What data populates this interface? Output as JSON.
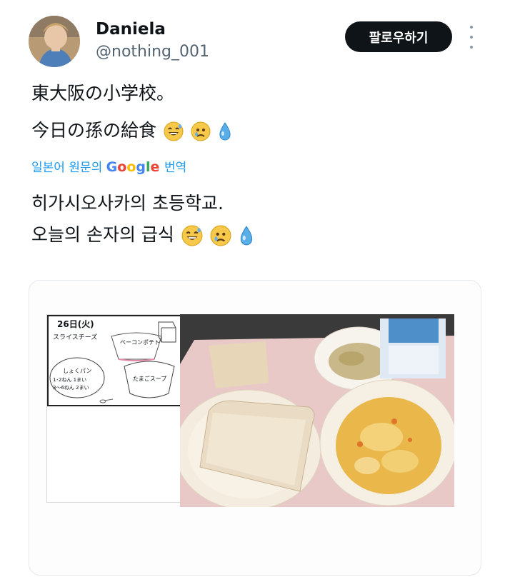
{
  "author": {
    "name": "Daniela",
    "handle": "@nothing_001"
  },
  "follow_button": "팔로우하기",
  "post": {
    "line1": "東大阪の小学校。",
    "line2": "今日の孫の給食"
  },
  "translation": {
    "prefix": "일본어 원문의",
    "google": "Google",
    "suffix": "번역"
  },
  "translated": {
    "line1": "히가시오사카의 초등학교.",
    "line2": "오늘의 손자의 급식"
  },
  "menu": {
    "date": "26日(火)",
    "item1": "スライスチーズ",
    "item2": "ベーコンポテト",
    "item3": "しょくパン",
    "item3_note1": "1･2ねん 1まい",
    "item3_note2": "3〜6ねん 2まい",
    "item4": "たまごスープ"
  },
  "icons": {
    "emoji": [
      "grinning-sweat-emoji",
      "crying-face-emoji",
      "droplet-emoji"
    ],
    "more": "more-vertical-icon"
  }
}
